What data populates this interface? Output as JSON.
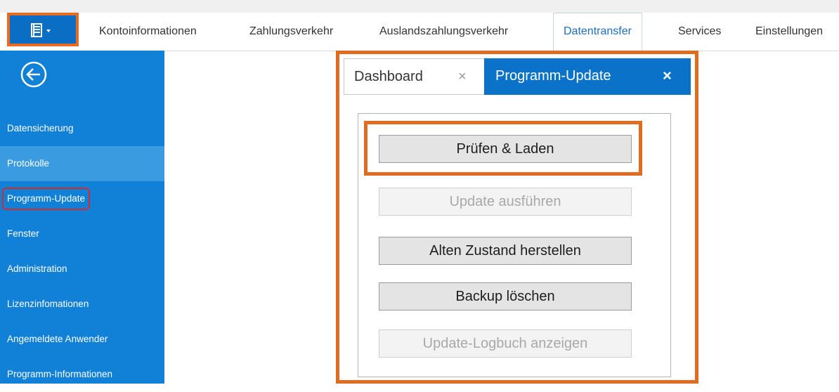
{
  "menu": {
    "items": [
      {
        "label": "Kontoinformationen"
      },
      {
        "label": "Zahlungsverkehr"
      },
      {
        "label": "Auslandszahlungsverkehr"
      },
      {
        "label": "Datentransfer",
        "active": true
      },
      {
        "label": "Services"
      },
      {
        "label": "Einstellungen"
      }
    ]
  },
  "sidebar": {
    "back_icon": "arrow-left-circle-icon",
    "items": [
      {
        "label": "Datensicherung"
      },
      {
        "label": "Protokolle",
        "selected": true
      },
      {
        "label": "Programm-Update",
        "circled": true
      },
      {
        "label": "Fenster"
      },
      {
        "label": "Administration"
      },
      {
        "label": "Lizenzinfomationen"
      },
      {
        "label": "Angemeldete Anwender"
      },
      {
        "label": "Programm-Informationen"
      }
    ]
  },
  "tabs": [
    {
      "label": "Dashboard",
      "close": "×"
    },
    {
      "label": "Programm-Update",
      "close": "×",
      "active": true
    }
  ],
  "buttons": {
    "check_load": "Prüfen & Laden",
    "run_update": "Update ausführen",
    "restore": "Alten Zustand herstellen",
    "delete_backup": "Backup löschen",
    "show_log": "Update-Logbuch anzeigen"
  },
  "colors": {
    "accent_blue": "#1181d8",
    "highlight_orange": "#e06c21",
    "circle_red": "#d72b2b"
  }
}
